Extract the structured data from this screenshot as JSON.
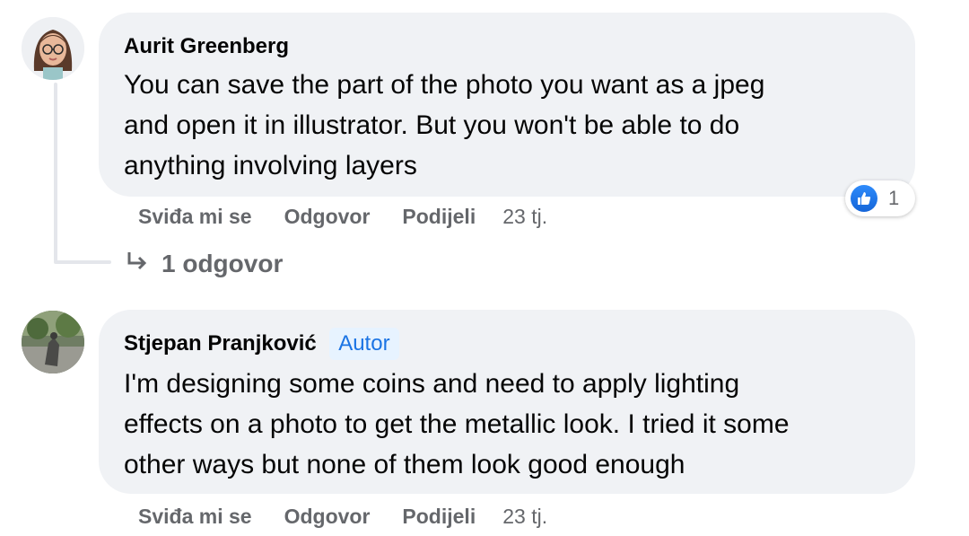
{
  "comments": [
    {
      "author": "Aurit Greenberg",
      "text": "You can save the part of the photo you want as a jpeg\nand open it in illustrator. But you won't be able to do\nanything involving layers",
      "actions": {
        "like": "Sviđa mi se",
        "reply": "Odgovor",
        "share": "Podijeli",
        "time": "23 tj."
      },
      "reaction": {
        "icon": "like-icon",
        "count": "1"
      },
      "replies_label": "1 odgovor"
    },
    {
      "author": "Stjepan Pranjković",
      "badge": "Autor",
      "text": "I'm designing some coins and need to apply lighting\neffects on a photo to get the metallic look. I tried it some\nother ways but none of them look good enough",
      "actions": {
        "like": "Sviđa mi se",
        "reply": "Odgovor",
        "share": "Podijeli",
        "time": "23 tj."
      }
    }
  ],
  "colors": {
    "bubble": "#f0f2f5",
    "link_blue": "#1b74e4",
    "secondary_text": "#65676b"
  }
}
